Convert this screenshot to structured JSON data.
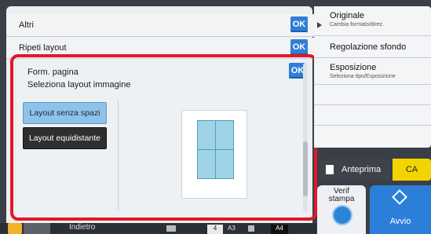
{
  "menu": {
    "altri": "Altri",
    "ripeti_layout": "Ripeti layout",
    "ok": "OK"
  },
  "panel": {
    "title": "Form. pagina",
    "subtitle": "Seleziona layout immagine",
    "layout_no_gap": "Layout senza spazi",
    "layout_equidistant": "Layout equidistante"
  },
  "right_menu": {
    "originale": "Originale",
    "originale_sub": "Cambia formato/direz.",
    "regolazione": "Regolazione sfondo",
    "esposizione": "Esposizione",
    "esposizione_sub": "Seleziona tipo/Esposizione"
  },
  "actions": {
    "anteprima": "Anteprima",
    "ca": "CA",
    "verif": "Verif",
    "stampa": "stampa",
    "avvio": "Avvio"
  },
  "footer": {
    "indietro": "Indietro",
    "count": "4",
    "size_a3": "A3",
    "size_a4": "A4"
  },
  "colors": {
    "accent": "#2f7fd6",
    "selection_frame": "#e0192a",
    "selected_button": "#8ec2e8",
    "ca_button": "#f3d300"
  }
}
